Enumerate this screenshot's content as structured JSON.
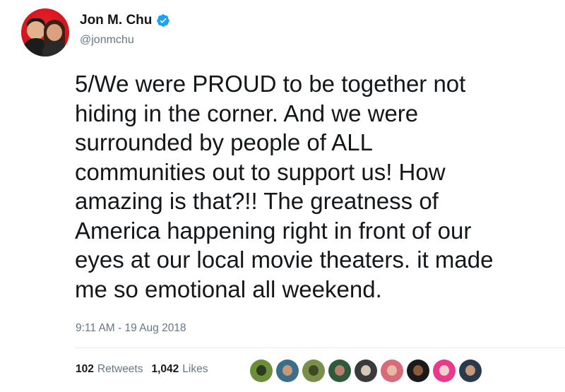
{
  "user": {
    "display_name": "Jon M. Chu",
    "handle": "@jonmchu",
    "verified": true,
    "avatar_icon": "profile-photo-two-people-red-background"
  },
  "tweet": {
    "text": "5/We were PROUD to be together not\nhiding in the corner. And we were\nsurrounded by people of ALL\ncommunities out to support us! How\namazing is that?!! The greatness of\nAmerica happening right in front of our\neyes at our local movie theaters. it made\nme so emotional all weekend.",
    "timestamp": "9:11 AM - 19 Aug 2018"
  },
  "stats": {
    "retweets_count": "102",
    "retweets_label": "Retweets",
    "likes_count": "1,042",
    "likes_label": "Likes"
  },
  "likers": [
    {
      "name": "liker-avatar-1",
      "bg": "#6b8e3a",
      "face": "#2d3a1c"
    },
    {
      "name": "liker-avatar-2",
      "bg": "#3a6e8a",
      "face": "#c89878"
    },
    {
      "name": "liker-avatar-3",
      "bg": "#7a8f4a",
      "face": "#3c4a24"
    },
    {
      "name": "liker-avatar-4",
      "bg": "#2e5a3a",
      "face": "#b8806a"
    },
    {
      "name": "liker-avatar-5",
      "bg": "#3a3a3a",
      "face": "#d8c8b8"
    },
    {
      "name": "liker-avatar-6",
      "bg": "#d86a7a",
      "face": "#e8b8a8"
    },
    {
      "name": "liker-avatar-7",
      "bg": "#1a1a1a",
      "face": "#8a5a3a"
    },
    {
      "name": "liker-avatar-8",
      "bg": "#e83a8a",
      "face": "#f0d0d0"
    },
    {
      "name": "liker-avatar-9",
      "bg": "#2a3a4a",
      "face": "#c8987a"
    }
  ],
  "colors": {
    "text": "#14171a",
    "secondary": "#657786",
    "verified_blue": "#1da1f2"
  }
}
